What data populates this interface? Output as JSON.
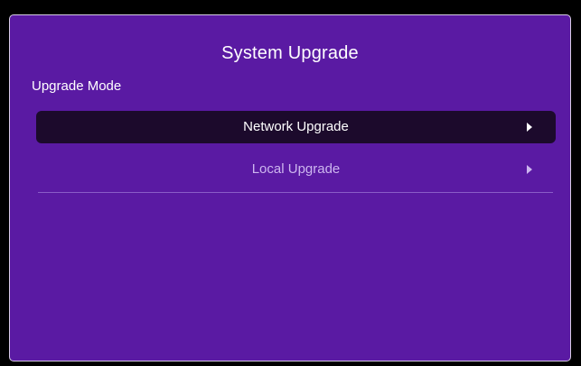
{
  "screen": {
    "title": "System Upgrade",
    "section_label": "Upgrade Mode"
  },
  "menu": {
    "items": [
      {
        "label": "Network Upgrade",
        "selected": true,
        "icon": "chevron-right-icon"
      },
      {
        "label": "Local Upgrade",
        "selected": false,
        "icon": "chevron-right-icon"
      }
    ]
  },
  "colors": {
    "panel_background": "#5a1aa3",
    "selected_row": "#1c0a2c",
    "text_primary": "#ffffff",
    "text_secondary": "#cdb6ef"
  }
}
